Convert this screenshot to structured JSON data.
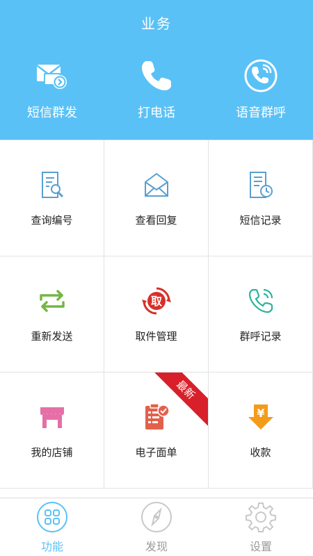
{
  "header": {
    "title": "业务",
    "quick_actions": [
      {
        "label": "短信群发",
        "icon": "sms-broadcast-icon"
      },
      {
        "label": "打电话",
        "icon": "phone-icon"
      },
      {
        "label": "语音群呼",
        "icon": "voice-call-icon"
      }
    ]
  },
  "grid": [
    {
      "label": "查询编号",
      "icon": "search-document-icon",
      "color": "#5a9fcf"
    },
    {
      "label": "查看回复",
      "icon": "open-envelope-icon",
      "color": "#5a9fcf"
    },
    {
      "label": "短信记录",
      "icon": "sms-record-icon",
      "color": "#5a9fcf"
    },
    {
      "label": "重新发送",
      "icon": "resend-arrows-icon",
      "color": "#74b643"
    },
    {
      "label": "取件管理",
      "icon": "pickup-icon",
      "color": "#d7302a"
    },
    {
      "label": "群呼记录",
      "icon": "call-record-icon",
      "color": "#2bb39c"
    },
    {
      "label": "我的店铺",
      "icon": "shop-icon",
      "color": "#e56fa6"
    },
    {
      "label": "电子面单",
      "icon": "e-waybill-icon",
      "color": "#e3604c",
      "badge": "最新"
    },
    {
      "label": "收款",
      "icon": "payment-icon",
      "color": "#f39c1b"
    }
  ],
  "pickup_glyph": "取",
  "currency_glyph": "¥",
  "tabs": [
    {
      "label": "功能",
      "icon": "grid-apps-icon",
      "active": true
    },
    {
      "label": "发现",
      "icon": "compass-icon",
      "active": false
    },
    {
      "label": "设置",
      "icon": "gear-icon",
      "active": false
    }
  ],
  "colors": {
    "header_bg": "#5ac1f6",
    "tab_active": "#5ac1f6",
    "tab_inactive": "#9a9a9a",
    "badge_bg": "#d7202a"
  }
}
